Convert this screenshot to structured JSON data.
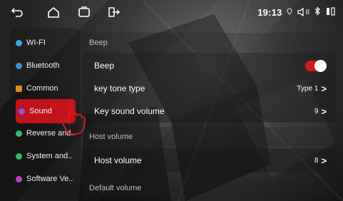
{
  "topbar": {
    "icons": [
      "back-icon",
      "home-icon",
      "recent-apps-icon",
      "input-source-icon"
    ],
    "time": "19:13",
    "status_icons": [
      "location-icon",
      "volume-icon",
      "bluetooth-icon",
      "battery-icon"
    ],
    "volume_level": "8"
  },
  "sidebar": {
    "items": [
      {
        "label": "WI-FI",
        "icon": "wifi-icon",
        "color": "#3aa7e0"
      },
      {
        "label": "Bluetooth",
        "icon": "bluetooth-icon",
        "color": "#3a8fe0"
      },
      {
        "label": "Common",
        "icon": "common-icon",
        "color": "#e08a1e"
      },
      {
        "label": "Sound",
        "icon": "sound-icon",
        "color": "#7a5ce0",
        "active": true
      },
      {
        "label": "Reverse and..",
        "icon": "reverse-icon",
        "color": "#2ebd6b"
      },
      {
        "label": "System and..",
        "icon": "system-icon",
        "color": "#2ebd6b"
      },
      {
        "label": "Software Ve..",
        "icon": "software-icon",
        "color": "#c040c0"
      }
    ]
  },
  "main": {
    "beep_header": "Beep",
    "beep_label": "Beep",
    "beep_on": true,
    "key_tone_label": "key tone type",
    "key_tone_value": "Type 1",
    "key_volume_label": "Key sound volume",
    "key_volume_value": "9",
    "host_header": "Host volume",
    "host_label": "Host volume",
    "host_value": "8",
    "default_header": "Default volume",
    "chevron": ">"
  },
  "colors": {
    "accent_red": "#c1131a",
    "toggle_on": "#d6181f"
  }
}
